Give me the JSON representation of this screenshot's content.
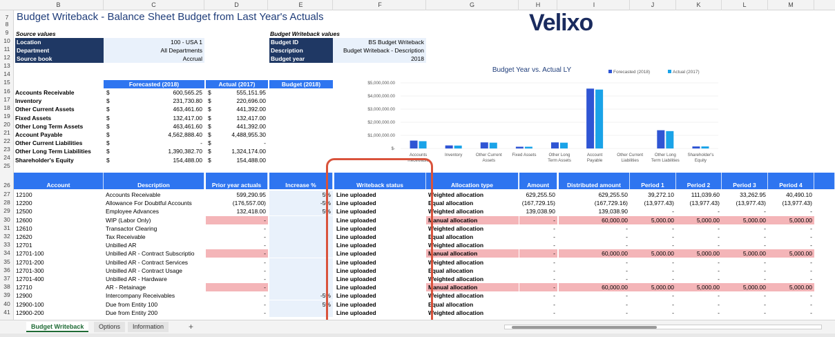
{
  "columns": [
    "B",
    "C",
    "D",
    "E",
    "F",
    "G",
    "H",
    "I",
    "J",
    "K",
    "L",
    "M"
  ],
  "title": "Budget Writeback - Balance Sheet Budget from Last Year's Actuals",
  "logo": "Velixo",
  "source_values": {
    "heading": "Source values",
    "rows": [
      {
        "label": "Location",
        "value": "100 - USA 1"
      },
      {
        "label": "Department",
        "value": "All Departments"
      },
      {
        "label": "Source book",
        "value": "Accrual"
      }
    ]
  },
  "budget_values": {
    "heading": "Budget Writeback values",
    "rows": [
      {
        "label": "Budget ID",
        "value": "BS Budget Writeback"
      },
      {
        "label": "Description",
        "value": "Budget Writeback - Description"
      },
      {
        "label": "Budget year",
        "value": "2018"
      }
    ]
  },
  "bs_table": {
    "headers": [
      "Forecasted (2018)",
      "Actual (2017)",
      "Budget (2018)"
    ],
    "currency": "$",
    "rows": [
      {
        "label": "Accounts Receivable",
        "forecast": "600,565.25",
        "actual": "555,151.95"
      },
      {
        "label": "Inventory",
        "forecast": "231,730.80",
        "actual": "220,696.00"
      },
      {
        "label": "Other Current Assets",
        "forecast": "463,461.60",
        "actual": "441,392.00"
      },
      {
        "label": "Fixed Assets",
        "forecast": "132,417.00",
        "actual": "132,417.00"
      },
      {
        "label": "Other Long Term Assets",
        "forecast": "463,461.60",
        "actual": "441,392.00"
      },
      {
        "label": "Account Payable",
        "forecast": "4,562,888.40",
        "actual": "4,488,955.30"
      },
      {
        "label": "Other Current Liabilities",
        "forecast": "-",
        "actual": "-"
      },
      {
        "label": "Other Long Term Liabilities",
        "forecast": "1,390,382.70",
        "actual": "1,324,174.00"
      },
      {
        "label": "Shareholder's Equity",
        "forecast": "154,488.00",
        "actual": "154,488.00"
      }
    ]
  },
  "chart_data": {
    "type": "bar",
    "title": "Budget Year vs. Actual LY",
    "categories": [
      "Accounts Receivable",
      "Inventory",
      "Other Current Assets",
      "Fixed Assets",
      "Other Long Term Assets",
      "Account Payable",
      "Other Current Liabilities",
      "Other Long Term Liabilities",
      "Shareholder's Equity"
    ],
    "series": [
      {
        "name": "Forecasted (2018)",
        "color": "#2f55d4",
        "values": [
          600565.25,
          231730.8,
          463461.6,
          132417,
          463461.6,
          4562888.4,
          0,
          1390382.7,
          154488
        ]
      },
      {
        "name": "Actual (2017)",
        "color": "#1aa3e8",
        "values": [
          555151.95,
          220696,
          441392,
          132417,
          441392,
          4488955.3,
          0,
          1324174,
          154488
        ]
      }
    ],
    "yticks": [
      "$5,000,000.00",
      "$4,000,000.00",
      "$3,000,000.00",
      "$2,000,000.00",
      "$1,000,000.00",
      "$-"
    ],
    "ylim": [
      0,
      5000000
    ],
    "legend": "top-right"
  },
  "grid": {
    "headers": [
      "Account",
      "Description",
      "Prior year actuals",
      "Increase %",
      "Writeback status",
      "Allocation type",
      "Amount",
      "Distributed amount",
      "Period 1",
      "Period 2",
      "Period 3",
      "Period 4"
    ],
    "rows": [
      {
        "n": "27",
        "acct": "12100",
        "desc": "Accounts Receivable",
        "prior": "599,290.95",
        "inc": "5%",
        "status": "Line uploaded",
        "alloc": "Weighted allocation",
        "amount": "629,255.50",
        "dist": "629,255.50",
        "p1": "39,272.10",
        "p2": "111,039.60",
        "p3": "33,262.95",
        "p4": "40,490.10",
        "pink": false
      },
      {
        "n": "28",
        "acct": "12200",
        "desc": "Allowance For Doubtful Accounts",
        "prior": "(176,557.00)",
        "inc": "-5%",
        "status": "Line uploaded",
        "alloc": "Equal allocation",
        "amount": "(167,729.15)",
        "dist": "(167,729.16)",
        "p1": "(13,977.43)",
        "p2": "(13,977.43)",
        "p3": "(13,977.43)",
        "p4": "(13,977.43)",
        "pink": false
      },
      {
        "n": "29",
        "acct": "12500",
        "desc": "Employee Advances",
        "prior": "132,418.00",
        "inc": "5%",
        "status": "Line uploaded",
        "alloc": "Weighted allocation",
        "amount": "139,038.90",
        "dist": "139,038.90",
        "p1": "-",
        "p2": "-",
        "p3": "-",
        "p4": "-",
        "pink": false
      },
      {
        "n": "30",
        "acct": "12600",
        "desc": "WIP (Labor Only)",
        "prior": "-",
        "inc": "",
        "status": "Line uploaded",
        "alloc": "Manual allocation",
        "amount": "-",
        "dist": "60,000.00",
        "p1": "5,000.00",
        "p2": "5,000.00",
        "p3": "5,000.00",
        "p4": "5,000.00",
        "pink": true
      },
      {
        "n": "31",
        "acct": "12610",
        "desc": "Transactor Clearing",
        "prior": "-",
        "inc": "",
        "status": "Line uploaded",
        "alloc": "Weighted allocation",
        "amount": "-",
        "dist": "-",
        "p1": "-",
        "p2": "-",
        "p3": "-",
        "p4": "-",
        "pink": false
      },
      {
        "n": "32",
        "acct": "12620",
        "desc": "Tax Receivable",
        "prior": "-",
        "inc": "",
        "status": "Line uploaded",
        "alloc": "Equal allocation",
        "amount": "-",
        "dist": "-",
        "p1": "-",
        "p2": "-",
        "p3": "-",
        "p4": "-",
        "pink": false
      },
      {
        "n": "33",
        "acct": "12701",
        "desc": "Unbilled AR",
        "prior": "-",
        "inc": "",
        "status": "Line uploaded",
        "alloc": "Weighted allocation",
        "amount": "-",
        "dist": "-",
        "p1": "-",
        "p2": "-",
        "p3": "-",
        "p4": "-",
        "pink": false
      },
      {
        "n": "34",
        "acct": "12701-100",
        "desc": "Unbilled AR - Contract Subscriptio",
        "prior": "-",
        "inc": "",
        "status": "Line uploaded",
        "alloc": "Manual allocation",
        "amount": "-",
        "dist": "60,000.00",
        "p1": "5,000.00",
        "p2": "5,000.00",
        "p3": "5,000.00",
        "p4": "5,000.00",
        "pink": true
      },
      {
        "n": "35",
        "acct": "12701-200",
        "desc": "Unbilled AR - Contract Services",
        "prior": "-",
        "inc": "",
        "status": "Line uploaded",
        "alloc": "Weighted allocation",
        "amount": "-",
        "dist": "-",
        "p1": "-",
        "p2": "-",
        "p3": "-",
        "p4": "-",
        "pink": false
      },
      {
        "n": "36",
        "acct": "12701-300",
        "desc": "Unbilled AR - Contract Usage",
        "prior": "-",
        "inc": "",
        "status": "Line uploaded",
        "alloc": "Equal allocation",
        "amount": "-",
        "dist": "-",
        "p1": "-",
        "p2": "-",
        "p3": "-",
        "p4": "-",
        "pink": false
      },
      {
        "n": "37",
        "acct": "12701-400",
        "desc": "Unbilled AR - Hardware",
        "prior": "-",
        "inc": "",
        "status": "Line uploaded",
        "alloc": "Weighted allocation",
        "amount": "-",
        "dist": "-",
        "p1": "-",
        "p2": "-",
        "p3": "-",
        "p4": "-",
        "pink": false
      },
      {
        "n": "38",
        "acct": "12710",
        "desc": "AR - Retainage",
        "prior": "-",
        "inc": "",
        "status": "Line uploaded",
        "alloc": "Manual allocation",
        "amount": "-",
        "dist": "60,000.00",
        "p1": "5,000.00",
        "p2": "5,000.00",
        "p3": "5,000.00",
        "p4": "5,000.00",
        "pink": true
      },
      {
        "n": "39",
        "acct": "12900",
        "desc": "Intercompany Receivables",
        "prior": "-",
        "inc": "-5%",
        "status": "Line uploaded",
        "alloc": "Weighted allocation",
        "amount": "-",
        "dist": "-",
        "p1": "-",
        "p2": "-",
        "p3": "-",
        "p4": "-",
        "pink": false
      },
      {
        "n": "40",
        "acct": "12900-100",
        "desc": "Due from Entity 100",
        "prior": "-",
        "inc": "5%",
        "status": "Line uploaded",
        "alloc": "Equal allocation",
        "amount": "-",
        "dist": "-",
        "p1": "-",
        "p2": "-",
        "p3": "-",
        "p4": "-",
        "pink": false
      },
      {
        "n": "41",
        "acct": "12900-200",
        "desc": "Due from Entity 200",
        "prior": "-",
        "inc": "",
        "status": "Line uploaded",
        "alloc": "Weighted allocation",
        "amount": "-",
        "dist": "-",
        "p1": "-",
        "p2": "-",
        "p3": "-",
        "p4": "-",
        "pink": false
      }
    ]
  },
  "tabs": [
    "Budget Writeback",
    "Options",
    "Information"
  ],
  "add_sheet": "+"
}
